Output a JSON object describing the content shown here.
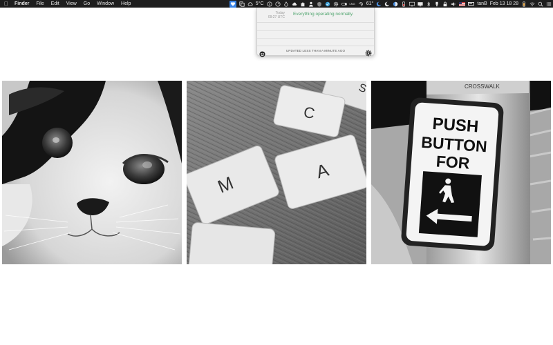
{
  "menubar": {
    "apple_icon": "apple-icon",
    "app_name": "Finder",
    "menus": [
      "File",
      "Edit",
      "View",
      "Go",
      "Window",
      "Help"
    ],
    "weather_temp": "5°C",
    "cpu_temp": "61°",
    "lng_label": "LNG",
    "user": "tanB",
    "clock": "Feb 13  18 28"
  },
  "popover": {
    "day": "Today",
    "time": "09:27 UTC",
    "status": "Everything operating normally.",
    "status_color": "#4ea46d",
    "updated": "UPDATED LESS THAN A MINUTE AGO"
  },
  "photos": {
    "crosswalk": {
      "line1": "PUSH",
      "line2": "BUTTON",
      "line3": "FOR",
      "top_label": "CROSSWALK"
    },
    "tiles": [
      "M",
      "A",
      "C",
      "S"
    ]
  }
}
